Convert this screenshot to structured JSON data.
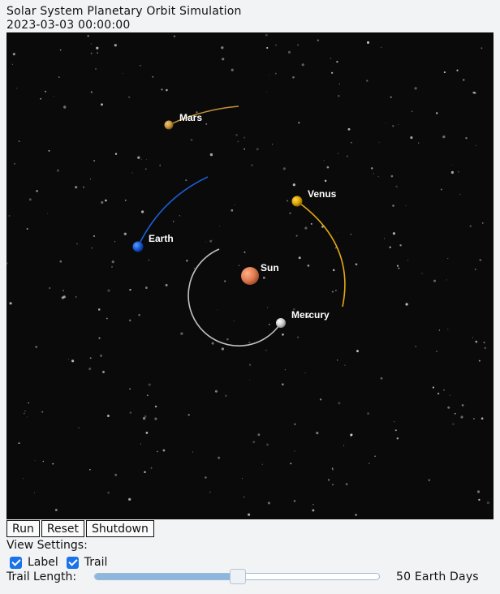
{
  "window": {
    "title": "Solar System Planetary Orbit Simulation",
    "timestamp": "2023-03-03 00:00:00"
  },
  "simulation": {
    "background": "#0a0a0a",
    "bodies": [
      {
        "name": "Sun",
        "color": "#e07a4f"
      },
      {
        "name": "Mercury",
        "color": "#cfcfcf"
      },
      {
        "name": "Venus",
        "color": "#d9a100"
      },
      {
        "name": "Earth",
        "color": "#1656d6"
      },
      {
        "name": "Mars",
        "color": "#c4923a"
      }
    ]
  },
  "controls": {
    "run_label": "Run",
    "reset_label": "Reset",
    "shutdown_label": "Shutdown"
  },
  "view_settings": {
    "heading": "View Settings:",
    "label_checkbox": {
      "text": "Label",
      "checked": true
    },
    "trail_checkbox": {
      "text": "Trail",
      "checked": true
    },
    "trail_length_label": "Trail Length:",
    "trail_length_value": "50 Earth Days",
    "trail_length_fraction": 0.5
  }
}
